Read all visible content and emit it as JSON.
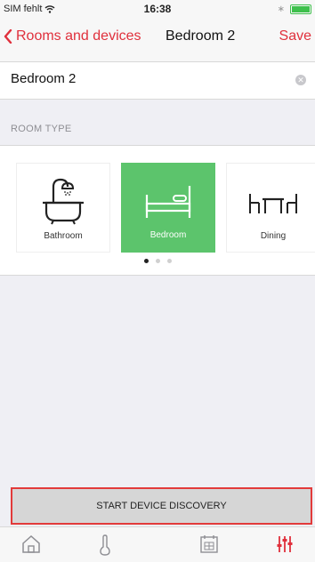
{
  "status": {
    "carrier": "SIM fehlt",
    "time": "16:38"
  },
  "nav": {
    "back_label": "Rooms and devices",
    "title": "Bedroom 2",
    "save_label": "Save"
  },
  "name_field": {
    "value": "Bedroom 2"
  },
  "room_type": {
    "header": "ROOM TYPE",
    "options": [
      {
        "label": "Bathroom",
        "icon": "bathtub-icon"
      },
      {
        "label": "Bedroom",
        "icon": "bed-icon",
        "selected": true
      },
      {
        "label": "Dining",
        "icon": "dining-table-icon"
      }
    ],
    "page_count": 3,
    "active_page": 1
  },
  "discovery_button": {
    "label": "START DEVICE DISCOVERY"
  },
  "tabs": [
    {
      "name": "home",
      "icon": "home-icon"
    },
    {
      "name": "climate",
      "icon": "thermometer-icon"
    },
    {
      "name": "schedule",
      "icon": "calendar-icon"
    },
    {
      "name": "settings",
      "icon": "sliders-icon",
      "active": true
    }
  ],
  "colors": {
    "accent": "#e0303c",
    "selected_room": "#5cc46c",
    "battery": "#3ec04c",
    "highlight_border": "#e23a3a"
  }
}
